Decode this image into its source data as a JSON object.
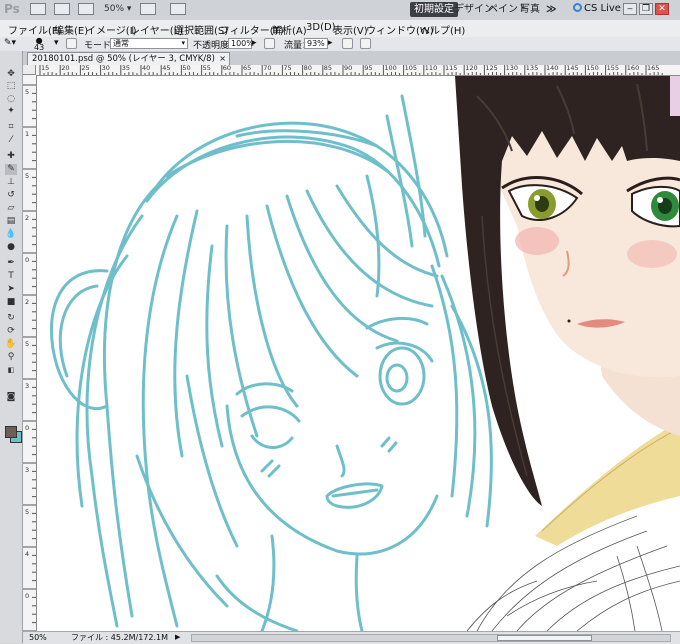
{
  "app": {
    "logo": "Ps",
    "zoom_dropdown": "50%",
    "workspaces": [
      "初期設定",
      "デザイン",
      "ペイント",
      "写真"
    ],
    "more": "≫",
    "cs_live": "CS Live",
    "window_buttons": [
      "‒",
      "❐",
      "✕"
    ]
  },
  "menu": {
    "items": [
      "ファイル(F)",
      "編集(E)",
      "イメージ(I)",
      "レイヤー(L)",
      "選択範囲(S)",
      "フィルター(T)",
      "解析(A)",
      "3D(D)",
      "表示(V)",
      "ウィンドウ(W)",
      "ヘルプ(H)"
    ]
  },
  "options": {
    "brush_size": "43",
    "mode_label": "モード：",
    "mode_value": "通常",
    "opacity_label": "不透明度：",
    "opacity_value": "100%",
    "flow_label": "流量：",
    "flow_value": "93%"
  },
  "document": {
    "tab_title": "20180101.psd @ 50% (レイヤー 3, CMYK/8)",
    "close": "×"
  },
  "ruler": {
    "top_labels": [
      "15",
      "20",
      "25",
      "30",
      "35",
      "40",
      "45",
      "50",
      "55",
      "60",
      "65",
      "70",
      "75",
      "80",
      "85",
      "90",
      "95",
      "100",
      "105",
      "110",
      "115",
      "120",
      "125",
      "130",
      "135",
      "140",
      "145",
      "150",
      "155",
      "160",
      "165"
    ],
    "left_labels": [
      "5",
      "1",
      "5",
      "2",
      "0",
      "2",
      "5",
      "3",
      "0",
      "3",
      "5",
      "4",
      "0"
    ]
  },
  "status": {
    "zoom": "50%",
    "file_info": "ファイル : 45.2M/172.1M",
    "arrow": "▶"
  },
  "tools": {
    "icons": [
      "move-icon",
      "marquee-icon",
      "lasso-icon",
      "quick-select-icon",
      "crop-icon",
      "eyedropper-icon",
      "healing-icon",
      "brush-icon",
      "stamp-icon",
      "history-brush-icon",
      "eraser-icon",
      "gradient-icon",
      "blur-icon",
      "dodge-icon",
      "pen-icon",
      "type-icon",
      "path-select-icon",
      "shape-icon",
      "3d-rotate-icon",
      "3d-orbit-icon",
      "hand-icon",
      "zoom-icon"
    ]
  },
  "colors": {
    "foreground": "#6b5f5a",
    "background": "#6dc0ca",
    "sketch": "#6fbfca",
    "hair": "#2e2320",
    "skin": "#f6e4d7",
    "kimono": "#efdc98"
  }
}
